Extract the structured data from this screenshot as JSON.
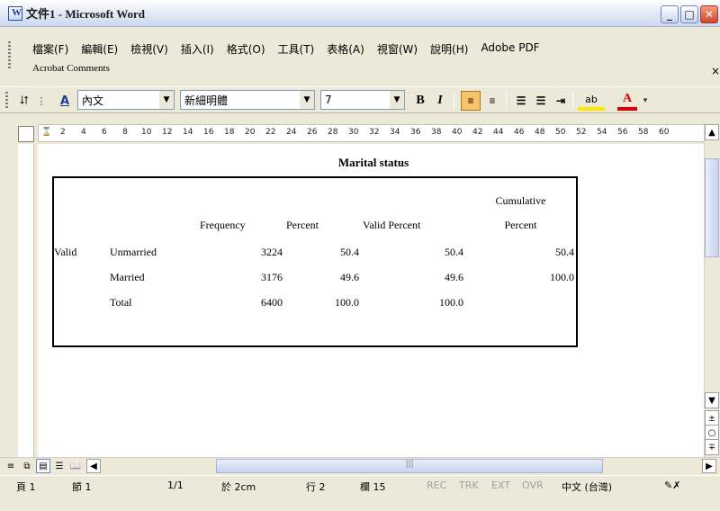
{
  "window": {
    "title": "文件1 - Microsoft Word"
  },
  "menu": {
    "items": [
      "檔案(F)",
      "編輯(E)",
      "檢視(V)",
      "插入(I)",
      "格式(O)",
      "工具(T)",
      "表格(A)",
      "視窗(W)",
      "說明(H)",
      "Adobe PDF"
    ],
    "row2": "Acrobat Comments",
    "more": "×"
  },
  "toolbar": {
    "style": "內文",
    "font": "新細明體",
    "size": "7",
    "bold": "B",
    "italic": "I",
    "highlight": "ab",
    "font_color": "A"
  },
  "ruler": {
    "numbers": [
      "2",
      "4",
      "6",
      "8",
      "10",
      "12",
      "14",
      "16",
      "18",
      "20",
      "22",
      "24",
      "26",
      "28",
      "30",
      "32",
      "34",
      "36",
      "38",
      "40",
      "42",
      "44",
      "46",
      "48",
      "50",
      "52",
      "54",
      "56",
      "58",
      "60"
    ]
  },
  "table": {
    "title": "Marital status",
    "headers": {
      "frequency": "Frequency",
      "percent": "Percent",
      "valid_percent": "Valid Percent",
      "cumulative_1": "Cumulative",
      "cumulative_2": "Percent"
    },
    "group": "Valid",
    "rows": [
      {
        "label": "Unmarried",
        "frequency": "3224",
        "percent": "50.4",
        "valid_percent": "50.4",
        "cumulative": "50.4"
      },
      {
        "label": "Married",
        "frequency": "3176",
        "percent": "49.6",
        "valid_percent": "49.6",
        "cumulative": "100.0"
      },
      {
        "label": "Total",
        "frequency": "6400",
        "percent": "100.0",
        "valid_percent": "100.0",
        "cumulative": ""
      }
    ]
  },
  "status": {
    "page": "頁 1",
    "section": "節 1",
    "pages": "1/1",
    "position": "於 2cm",
    "line": "行 2",
    "column": "欄 15",
    "rec": "REC",
    "trk": "TRK",
    "ext": "EXT",
    "ovr": "OVR",
    "language": "中文 (台灣)"
  }
}
